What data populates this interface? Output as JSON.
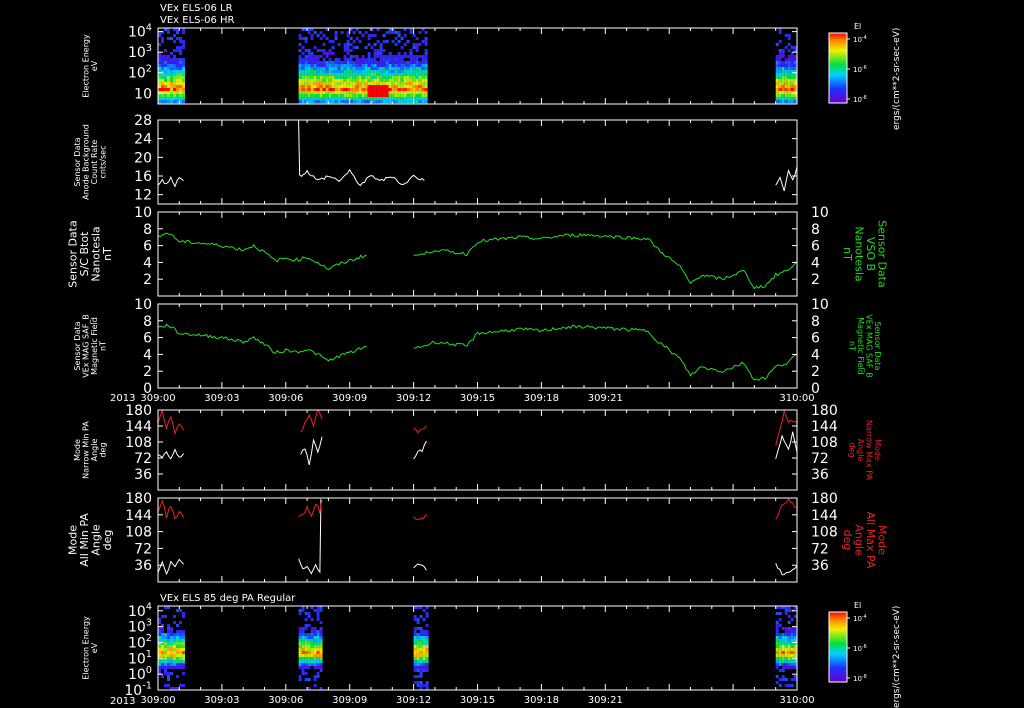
{
  "header": {
    "line1": "VEx ELS-06 LR",
    "line2": "VEx ELS-06 HR",
    "panel7_title": "VEx ELS 85 deg PA Regular"
  },
  "colorbar_unit": "ergs/(cm**2-sr-sec-eV)",
  "colors": {
    "white": "#ffffff",
    "green": "#22dd22",
    "red": "#ee2020",
    "background": "#000000"
  },
  "chart_data": [
    {
      "type": "heatmap",
      "name": "panel1-spectrogram",
      "ylabel": [
        "Electron Energy",
        "eV"
      ],
      "yscale": "log",
      "ylim": [
        3,
        15000
      ],
      "yticks": [
        "10",
        "10^2",
        "10^3",
        "10^4"
      ],
      "colorbar": {
        "label": "El",
        "ticks": [
          "10^-4",
          "10^-6",
          "10^-8"
        ]
      },
      "data_intervals": [
        [
          0.0,
          1.2
        ],
        [
          6.6,
          12.6
        ],
        [
          29.0,
          30.0
        ]
      ],
      "bright_band_energy_eV": 15,
      "peak_intensity_interval": [
        9.8,
        10.8
      ]
    },
    {
      "type": "line",
      "name": "panel2-anode-background",
      "ylabel": [
        "Sensor Data",
        "Anode Background",
        "Count Rate",
        "cnts/sec"
      ],
      "ylim": [
        10,
        28
      ],
      "yticks": [
        12,
        16,
        20,
        24,
        28
      ],
      "series": [
        {
          "color": "#ffffff",
          "segments": [
            {
              "x": [
                0.0,
                0.2,
                0.4,
                0.6,
                0.8,
                1.0,
                1.2
              ],
              "y": [
                14,
                15,
                14.5,
                15.5,
                14,
                16,
                15
              ]
            },
            {
              "x": [
                6.6,
                6.65,
                7.0,
                7.5,
                8.0,
                8.5,
                9.0,
                9.5,
                10.0,
                10.5,
                11.0,
                11.5,
                12.0,
                12.5
              ],
              "y": [
                28,
                16,
                17,
                15,
                16,
                15,
                17,
                14,
                16,
                15,
                16,
                14,
                16,
                15
              ]
            },
            {
              "x": [
                29.0,
                29.2,
                29.4,
                29.6,
                29.8,
                30.0
              ],
              "y": [
                14,
                16,
                13,
                17,
                15,
                18
              ]
            }
          ]
        }
      ]
    },
    {
      "type": "line",
      "name": "panel3-b-vso",
      "ylabel": [
        "Sensor Data",
        "S/C Btot",
        "Nanotesla",
        "nT"
      ],
      "ylabel_right": [
        "Sensor Data",
        "VSO B",
        "Nanotesla",
        "nT"
      ],
      "ylim": [
        0,
        10
      ],
      "yticks": [
        2,
        4,
        6,
        8,
        10
      ],
      "series": [
        {
          "color": "#22dd22",
          "segments": [
            {
              "x": [
                0,
                0.5,
                1,
                2,
                3,
                4,
                4.5,
                5,
                5.5,
                6,
                6.5,
                7,
                7.5,
                8,
                8.5,
                9.8
              ],
              "y": [
                7.2,
                7.5,
                6.5,
                6.3,
                6.0,
                5.5,
                6.0,
                5.2,
                4.2,
                4.5,
                4.3,
                4.6,
                4.0,
                3.2,
                3.8,
                4.9
              ]
            },
            {
              "x": [
                12.0,
                12.5,
                13.0,
                14.5,
                15.0,
                17.0,
                18.0,
                19.0,
                20.0,
                23.0,
                23.5,
                24.5,
                25.0,
                25.5,
                26.5,
                27.5,
                28.0,
                28.5,
                29.0,
                29.5,
                30.0
              ],
              "y": [
                4.8,
                5.0,
                5.5,
                5.0,
                6.5,
                7.0,
                6.8,
                7.2,
                7.3,
                6.8,
                5.5,
                3.5,
                1.5,
                2.5,
                2.0,
                3.0,
                1.0,
                1.2,
                2.5,
                3.0,
                4.0
              ]
            }
          ]
        }
      ]
    },
    {
      "type": "line",
      "name": "panel4-mag-saf-b",
      "ylabel": [
        "Sensor Data",
        "VEx MAG SAF_B",
        "Magnetic Field",
        "nT"
      ],
      "ylabel_right": [
        "Sensor Data",
        "VEx MAG SAF_B",
        "Magnetic Field",
        "nT"
      ],
      "ylim": [
        0,
        10
      ],
      "yticks": [
        0,
        2,
        4,
        6,
        8,
        10
      ],
      "series": [
        {
          "color": "#22dd22",
          "segments": [
            {
              "x": [
                0,
                0.5,
                1,
                2,
                3,
                4,
                4.5,
                5,
                5.5,
                6,
                6.5,
                7,
                7.5,
                8,
                8.5,
                9.8
              ],
              "y": [
                7.2,
                7.5,
                6.5,
                6.3,
                6.0,
                5.5,
                6.0,
                5.2,
                4.2,
                4.5,
                4.3,
                4.6,
                4.0,
                3.2,
                3.8,
                4.9
              ]
            },
            {
              "x": [
                12.0,
                12.5,
                13.0,
                14.5,
                15.0,
                17.0,
                18.0,
                19.0,
                20.0,
                23.0,
                23.5,
                24.5,
                25.0,
                25.5,
                26.5,
                27.5,
                28.0,
                28.5,
                29.0,
                29.5,
                30.0
              ],
              "y": [
                4.8,
                5.0,
                5.5,
                5.0,
                6.5,
                7.0,
                6.8,
                7.2,
                7.3,
                6.8,
                5.5,
                3.5,
                1.5,
                2.5,
                2.0,
                3.0,
                1.0,
                1.2,
                2.5,
                3.0,
                4.0
              ]
            }
          ]
        }
      ]
    },
    {
      "type": "line",
      "name": "panel5-narrow-pa",
      "ylabel": [
        "Mode",
        "Narrow Min PA",
        "Angle",
        "deg"
      ],
      "ylabel_right": [
        "Mode",
        "Narrow Max PA",
        "Angle",
        "deg"
      ],
      "ylim": [
        0,
        180
      ],
      "yticks": [
        36,
        72,
        108,
        144,
        180
      ],
      "series": [
        {
          "name": "Min PA",
          "color": "#ffffff",
          "segments": [
            {
              "x": [
                0,
                0.2,
                0.4,
                0.6,
                0.8,
                1.0,
                1.2
              ],
              "y": [
                80,
                70,
                85,
                72,
                90,
                75,
                82
              ]
            },
            {
              "x": [
                6.7,
                6.9,
                7.1,
                7.3,
                7.5,
                7.7
              ],
              "y": [
                80,
                95,
                60,
                110,
                85,
                120
              ]
            },
            {
              "x": [
                12.0,
                12.2,
                12.4,
                12.6
              ],
              "y": [
                70,
                90,
                85,
                110
              ]
            },
            {
              "x": [
                29.0,
                29.3,
                29.6,
                29.8,
                30.0
              ],
              "y": [
                70,
                120,
                90,
                130,
                85
              ]
            }
          ]
        },
        {
          "name": "Max PA",
          "color": "#ee2020",
          "segments": [
            {
              "x": [
                0,
                0.2,
                0.4,
                0.6,
                0.8,
                1.0,
                1.2
              ],
              "y": [
                150,
                175,
                140,
                165,
                130,
                150,
                135
              ]
            },
            {
              "x": [
                6.7,
                6.9,
                7.1,
                7.3,
                7.5,
                7.7
              ],
              "y": [
                130,
                150,
                170,
                145,
                178,
                160
              ]
            },
            {
              "x": [
                12.0,
                12.2,
                12.4,
                12.6
              ],
              "y": [
                140,
                130,
                135,
                145
              ]
            },
            {
              "x": [
                29.0,
                29.2,
                29.4,
                29.6,
                30.0
              ],
              "y": [
                100,
                140,
                175,
                155,
                150
              ]
            }
          ]
        }
      ]
    },
    {
      "type": "line",
      "name": "panel6-all-pa",
      "ylabel": [
        "Mode",
        "All Min PA",
        "Angle",
        "deg"
      ],
      "ylabel_right": [
        "Mode",
        "All Max PA",
        "Angle",
        "deg"
      ],
      "ylim": [
        0,
        180
      ],
      "yticks": [
        36,
        72,
        108,
        144,
        180
      ],
      "series": [
        {
          "name": "Min PA",
          "color": "#ffffff",
          "segments": [
            {
              "x": [
                0,
                0.2,
                0.4,
                0.6,
                0.8,
                1.0,
                1.2
              ],
              "y": [
                20,
                40,
                15,
                45,
                30,
                48,
                38
              ]
            },
            {
              "x": [
                6.6,
                6.8,
                7.0,
                7.2,
                7.4,
                7.6,
                7.65,
                7.7
              ],
              "y": [
                50,
                25,
                35,
                20,
                40,
                20,
                175,
                175
              ]
            },
            {
              "x": [
                12.0,
                12.2,
                12.4,
                12.6
              ],
              "y": [
                30,
                42,
                35,
                25
              ]
            },
            {
              "x": [
                29.0,
                29.3,
                29.6,
                30.0
              ],
              "y": [
                40,
                15,
                20,
                35
              ]
            }
          ]
        },
        {
          "name": "Max PA",
          "color": "#ee2020",
          "segments": [
            {
              "x": [
                0,
                0.2,
                0.4,
                0.6,
                0.8,
                1.0,
                1.2
              ],
              "y": [
                150,
                175,
                140,
                165,
                135,
                150,
                138
              ]
            },
            {
              "x": [
                6.6,
                6.8,
                7.0,
                7.2,
                7.4,
                7.6,
                7.7
              ],
              "y": [
                140,
                145,
                160,
                140,
                170,
                150,
                175
              ]
            },
            {
              "x": [
                12.0,
                12.2,
                12.4,
                12.6
              ],
              "y": [
                140,
                130,
                135,
                145
              ]
            },
            {
              "x": [
                29.0,
                29.3,
                29.6,
                30.0
              ],
              "y": [
                135,
                165,
                175,
                160
              ]
            }
          ]
        }
      ]
    },
    {
      "type": "heatmap",
      "name": "panel7-spectrogram",
      "title": "VEx ELS 85 deg PA Regular",
      "ylabel": [
        "Electron Energy",
        "eV"
      ],
      "yscale": "log",
      "ylim": [
        0.1,
        20000
      ],
      "yticks": [
        "10^-1",
        "10^0",
        "10^1",
        "10^2",
        "10^3",
        "10^4"
      ],
      "colorbar": {
        "label": "El",
        "ticks": [
          "10^-4",
          "10^-6",
          "10^-8"
        ]
      },
      "data_intervals": [
        [
          0.0,
          1.2
        ],
        [
          6.6,
          7.7
        ],
        [
          12.0,
          12.6
        ],
        [
          29.0,
          30.0
        ]
      ],
      "bright_band_energy_eV": 20
    }
  ],
  "x_axis": {
    "year_label": "2013",
    "tick_labels": [
      "309:00",
      "309:03",
      "309:06",
      "309:09",
      "309:12",
      "309:15",
      "309:18",
      "309:21",
      "310:00"
    ],
    "xlim_minutes": [
      0,
      30
    ]
  }
}
